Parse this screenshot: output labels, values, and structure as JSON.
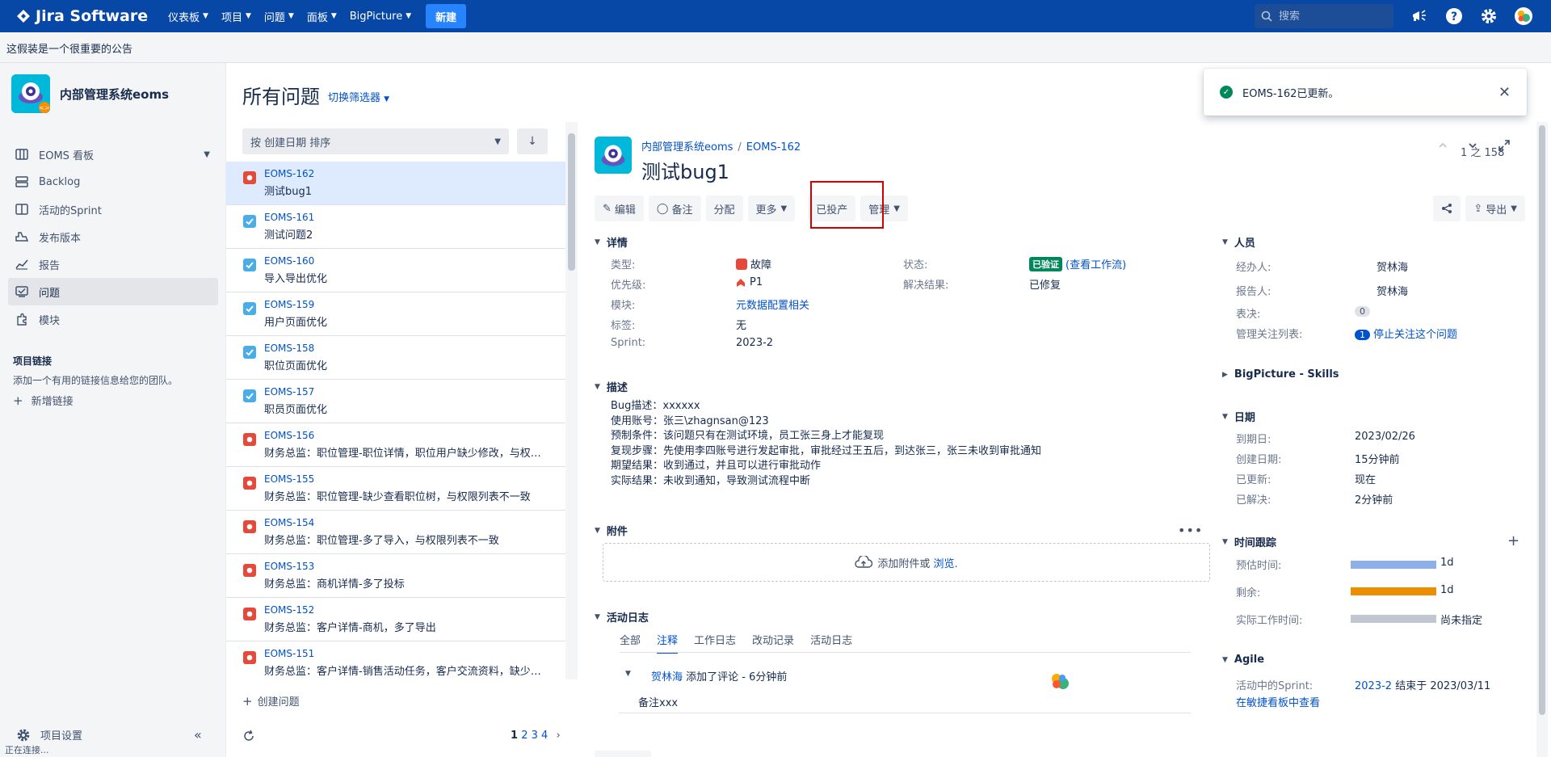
{
  "topnav": {
    "app_name": "Jira Software",
    "menus": [
      {
        "label": "仪表板"
      },
      {
        "label": "项目"
      },
      {
        "label": "问题"
      },
      {
        "label": "面板"
      },
      {
        "label": "BigPicture"
      }
    ],
    "create_label": "新建",
    "search_placeholder": "搜索",
    "icons": [
      "megaphone-icon",
      "help-icon",
      "settings-icon",
      "avatar"
    ],
    "color": "#0747a6"
  },
  "announcement": "这假装是一个很重要的公告",
  "sidebar": {
    "project_name": "内部管理系统eoms",
    "items": [
      {
        "label": "EOMS 看板",
        "icon": "board-icon"
      },
      {
        "label": "Backlog",
        "icon": "backlog-icon"
      },
      {
        "label": "活动的Sprint",
        "icon": "sprint-icon"
      },
      {
        "label": "发布版本",
        "icon": "release-icon"
      },
      {
        "label": "报告",
        "icon": "report-icon"
      },
      {
        "label": "问题",
        "icon": "issues-icon"
      },
      {
        "label": "模块",
        "icon": "components-icon"
      }
    ],
    "links_title": "项目链接",
    "links_desc": "添加一个有用的链接信息给您的团队。",
    "add_link": "新增链接",
    "settings": "项目设置"
  },
  "status_bar": "正在连接...",
  "page": {
    "title": "所有问题",
    "switch_filter": "切换筛选器"
  },
  "list": {
    "sort_label": "按 创建日期 排序",
    "issues": [
      {
        "key": "EOMS-162",
        "summary": "测试bug1",
        "type": "bug",
        "selected": true
      },
      {
        "key": "EOMS-161",
        "summary": "测试问题2",
        "type": "task"
      },
      {
        "key": "EOMS-160",
        "summary": "导入导出优化",
        "type": "task"
      },
      {
        "key": "EOMS-159",
        "summary": "用户页面优化",
        "type": "task"
      },
      {
        "key": "EOMS-158",
        "summary": "职位页面优化",
        "type": "task"
      },
      {
        "key": "EOMS-157",
        "summary": "职员页面优化",
        "type": "task"
      },
      {
        "key": "EOMS-156",
        "summary": "财务总监：职位管理-职位详情，职位用户缺少修改，与权限列表不一致",
        "type": "bug"
      },
      {
        "key": "EOMS-155",
        "summary": "财务总监：职位管理-缺少查看职位树，与权限列表不一致",
        "type": "bug"
      },
      {
        "key": "EOMS-154",
        "summary": "财务总监：职位管理-多了导入，与权限列表不一致",
        "type": "bug"
      },
      {
        "key": "EOMS-153",
        "summary": "财务总监：商机详情-多了投标",
        "type": "bug"
      },
      {
        "key": "EOMS-152",
        "summary": "财务总监：客户详情-商机，多了导出",
        "type": "bug"
      },
      {
        "key": "EOMS-151",
        "summary": "财务总监：客户详情-销售活动任务，客户交流资料，缺少操作",
        "type": "bug"
      }
    ],
    "create_issue": "创建问题",
    "pager": {
      "current": "1",
      "pages": [
        "2",
        "3",
        "4"
      ]
    }
  },
  "issue": {
    "project_crumb": "内部管理系统eoms",
    "key": "EOMS-162",
    "title": "测试bug1",
    "position": "1 之 158",
    "toolbar": {
      "edit": "编辑",
      "comment": "备注",
      "assign": "分配",
      "more": "更多",
      "production": "已投产",
      "admin": "管理",
      "export": "导出"
    },
    "details_title": "详情",
    "fields": {
      "type_label": "类型:",
      "type_value": "故障",
      "priority_label": "优先级:",
      "priority_value": "P1",
      "component_label": "模块:",
      "component_value": "元数据配置相关",
      "labels_label": "标签:",
      "labels_value": "无",
      "sprint_label": "Sprint:",
      "sprint_value": "2023-2",
      "status_label": "状态:",
      "status_value": "已验证",
      "workflow_link": "(查看工作流)",
      "resolution_label": "解决结果:",
      "resolution_value": "已修复"
    },
    "description_title": "描述",
    "description": [
      "Bug描述：xxxxxx",
      "使用账号：张三\\zhagnsan@123",
      "预制条件：该问题只有在测试环境，员工张三身上才能复现",
      "复现步骤：先使用李四账号进行发起审批，审批经过王五后，到达张三，张三未收到审批通知",
      "期望结果：收到通过，并且可以进行审批动作",
      "实际结果：未收到通知，导致测试流程中断"
    ],
    "attachments_title": "附件",
    "attach_text": "添加附件或",
    "attach_browse": "浏览.",
    "activity_title": "活动日志",
    "activity_tabs": [
      "全部",
      "注释",
      "工作日志",
      "改动记录",
      "活动日志"
    ],
    "activity_active": 1,
    "comment": {
      "author": "贺林海",
      "action": "添加了评论 - 6分钟前",
      "body": "备注xxx"
    },
    "cut_button": "备注"
  },
  "people": {
    "title": "人员",
    "assignee_label": "经办人:",
    "assignee": "贺林海",
    "reporter_label": "报告人:",
    "reporter": "贺林海",
    "votes_label": "表决:",
    "votes": "0",
    "watchers_label": "管理关注列表:",
    "watchers": "1",
    "watch_link": "停止关注这个问题"
  },
  "bigpicture": "BigPicture - Skills",
  "dates": {
    "title": "日期",
    "due_label": "到期日:",
    "due": "2023/02/26",
    "created_label": "创建日期:",
    "created": "15分钟前",
    "updated_label": "已更新:",
    "updated": "现在",
    "resolved_label": "已解决:",
    "resolved": "2分钟前"
  },
  "time": {
    "title": "时间跟踪",
    "estimated_label": "预估时间:",
    "estimated": "1d",
    "estimated_color": "#8eb0e7",
    "remaining_label": "剩余:",
    "remaining": "1d",
    "remaining_color": "#ec8e00",
    "logged_label": "实际工作时间:",
    "logged": "尚未指定"
  },
  "agile": {
    "title": "Agile",
    "sprint_label": "活动中的Sprint:",
    "sprint": "2023-2",
    "sprint_end": "结束于 2023/03/11",
    "board_link": "在敏捷看板中查看"
  },
  "toast": {
    "message": "EOMS-162已更新。"
  }
}
